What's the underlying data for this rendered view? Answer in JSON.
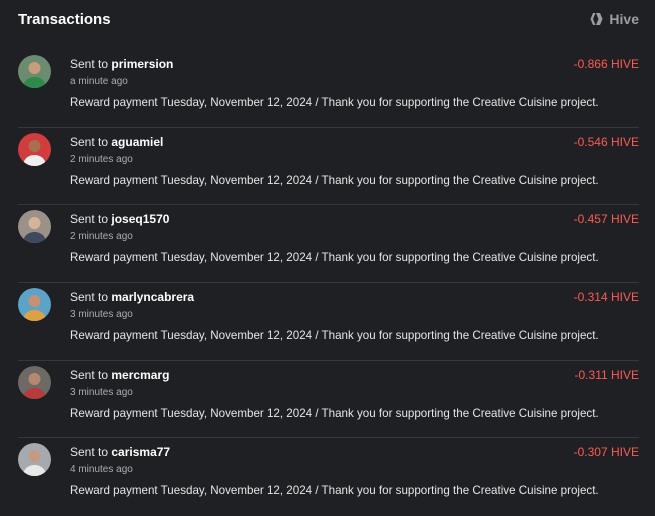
{
  "header": {
    "title": "Transactions",
    "brand_label": "Hive"
  },
  "colors": {
    "background": "#1e2024",
    "amount_negative": "#ff5a52",
    "divider": "#34373c"
  },
  "transactions": [
    {
      "prefix": "Sent to",
      "user": "primersion",
      "time": "a minute ago",
      "amount": "-0.866 HIVE",
      "memo": "Reward payment Tuesday, November 12, 2024 / Thank you for supporting the Creative Cuisine project.",
      "avatar_color": "#4f7a55"
    },
    {
      "prefix": "Sent to",
      "user": "aguamiel",
      "time": "2 minutes ago",
      "amount": "-0.546 HIVE",
      "memo": "Reward payment Tuesday, November 12, 2024 / Thank you for supporting the Creative Cuisine project.",
      "avatar_color": "#c23a3a"
    },
    {
      "prefix": "Sent to",
      "user": "joseq1570",
      "time": "2 minutes ago",
      "amount": "-0.457 HIVE",
      "memo": "Reward payment Tuesday, November 12, 2024 / Thank you for supporting the Creative Cuisine project.",
      "avatar_color": "#7d7466"
    },
    {
      "prefix": "Sent to",
      "user": "marlyncabrera",
      "time": "3 minutes ago",
      "amount": "-0.314 HIVE",
      "memo": "Reward payment Tuesday, November 12, 2024 / Thank you for supporting the Creative Cuisine project.",
      "avatar_color": "#3f86b0"
    },
    {
      "prefix": "Sent to",
      "user": "mercmarg",
      "time": "3 minutes ago",
      "amount": "-0.311 HIVE",
      "memo": "Reward payment Tuesday, November 12, 2024 / Thank you for supporting the Creative Cuisine project.",
      "avatar_color": "#8a5a5a"
    },
    {
      "prefix": "Sent to",
      "user": "carisma77",
      "time": "4 minutes ago",
      "amount": "-0.307 HIVE",
      "memo": "Reward payment Tuesday, November 12, 2024 / Thank you for supporting the Creative Cuisine project.",
      "avatar_color": "#8a8f94"
    }
  ]
}
